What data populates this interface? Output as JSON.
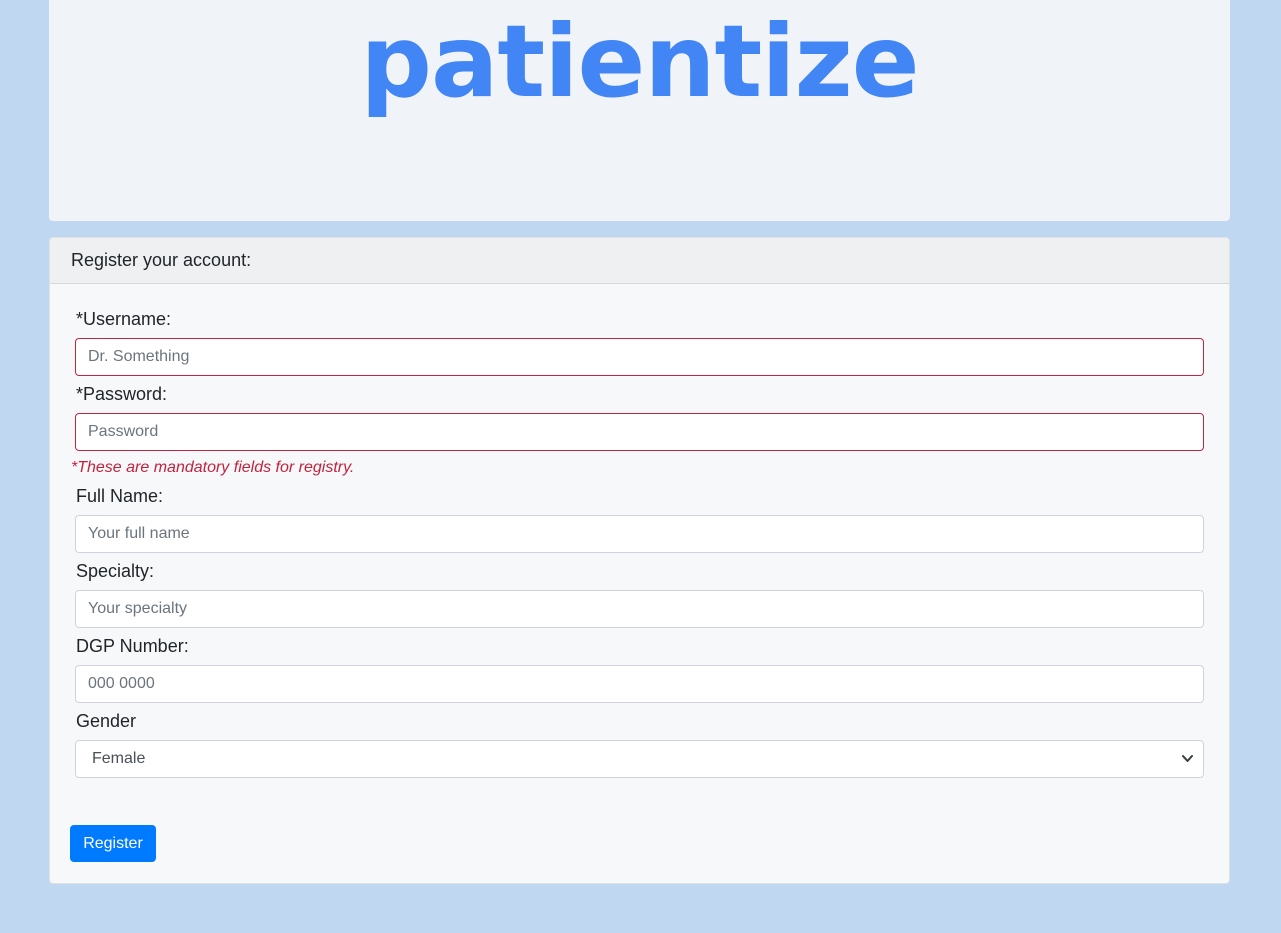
{
  "logo": {
    "text": "patientize",
    "color": "#4285f4"
  },
  "form": {
    "header": "Register your account:",
    "username": {
      "label": "*Username:",
      "placeholder": "Dr. Something",
      "value": ""
    },
    "password": {
      "label": "*Password:",
      "placeholder": "Password",
      "value": ""
    },
    "mandatory_note": "*These are mandatory fields for registry.",
    "full_name": {
      "label": "Full Name:",
      "placeholder": "Your full name",
      "value": ""
    },
    "specialty": {
      "label": "Specialty:",
      "placeholder": "Your specialty",
      "value": ""
    },
    "dgp_number": {
      "label": "DGP Number:",
      "placeholder": "000 0000",
      "value": ""
    },
    "gender": {
      "label": "Gender",
      "selected": "Female",
      "icon": "chevron-down-icon"
    },
    "register_button": "Register"
  },
  "colors": {
    "page_background": "#c0d7f2",
    "error": "#c0243f",
    "primary_button": "#007bff"
  }
}
